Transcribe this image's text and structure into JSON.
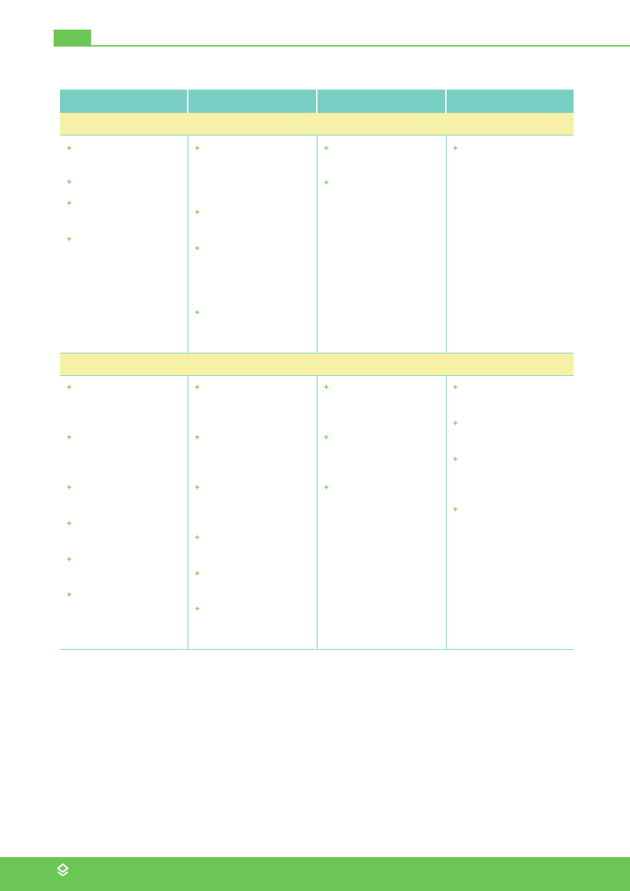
{
  "header": {
    "accent_color": "#6cc655"
  },
  "table": {
    "header_color": "#7acfc4",
    "band_color": "#f6f1a6",
    "bullet_icon": "four-point-star-icon",
    "bullet_glyph": "✦",
    "columns": [
      "",
      "",
      "",
      ""
    ],
    "sections": [
      {
        "band_label": "",
        "rows": [
          [
            4,
            4,
            2,
            1
          ]
        ]
      },
      {
        "band_label": "",
        "rows": [
          [
            6,
            6,
            3,
            4
          ]
        ]
      }
    ]
  },
  "footer": {
    "logo_icon": "diamond-logo-icon"
  }
}
